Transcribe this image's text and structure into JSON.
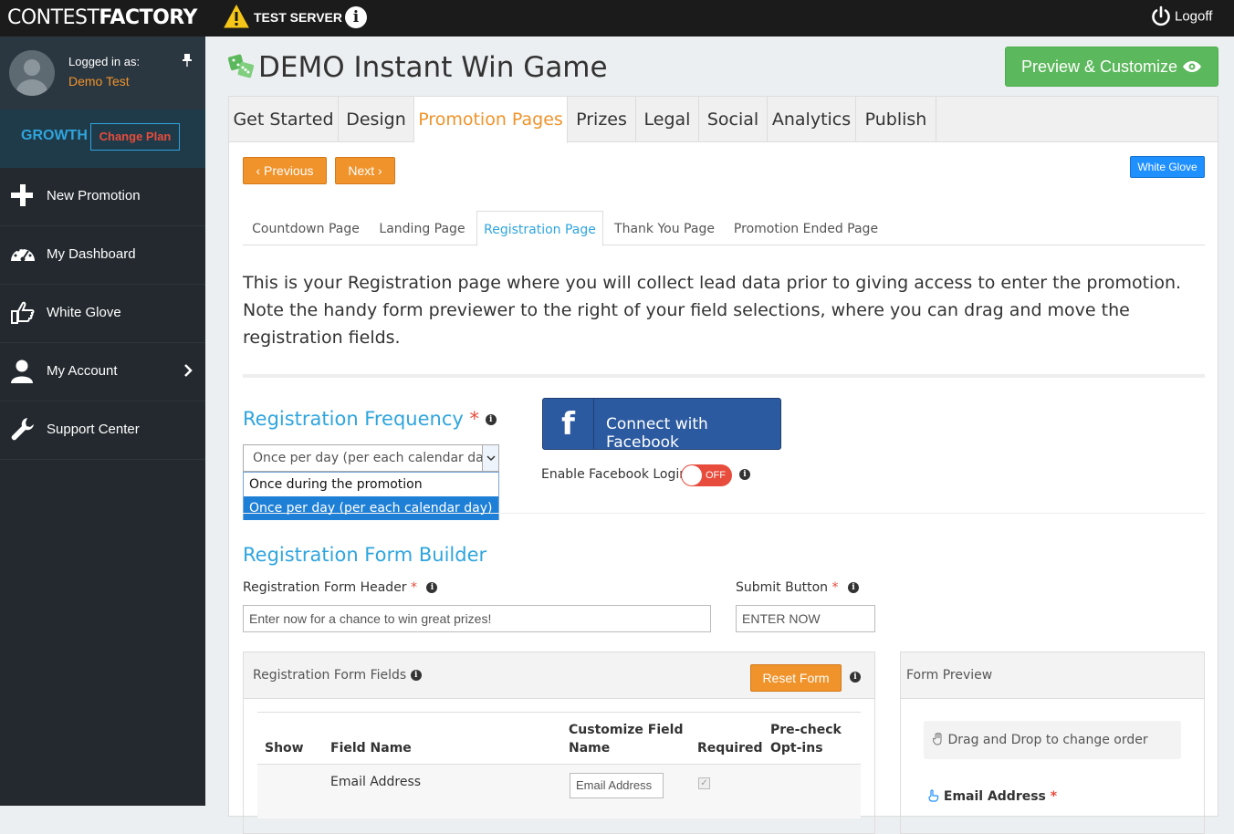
{
  "topbar": {
    "logo_light": "CONTEST",
    "logo_bold": "FACTORY",
    "server_label": "TEST SERVER",
    "info_glyph": "i",
    "logoff_label": "Logoff"
  },
  "sidebar": {
    "logged_in_label": "Logged in as:",
    "username": "Demo Test",
    "plan": "GROWTH",
    "change_plan_label": "Change Plan",
    "items": [
      {
        "label": "New Promotion",
        "icon": "plus-icon"
      },
      {
        "label": "My Dashboard",
        "icon": "dashboard-icon"
      },
      {
        "label": "White Glove",
        "icon": "hand-pointer-icon"
      },
      {
        "label": "My Account",
        "icon": "user-icon"
      },
      {
        "label": "Support Center",
        "icon": "wrench-icon"
      }
    ]
  },
  "header": {
    "title": "DEMO Instant Win Game",
    "preview_label": "Preview & Customize"
  },
  "tabs": [
    "Get Started",
    "Design",
    "Promotion Pages",
    "Prizes",
    "Legal",
    "Social",
    "Analytics",
    "Publish"
  ],
  "active_tab": "Promotion Pages",
  "buttons": {
    "previous": "‹ Previous",
    "next": "Next ›",
    "white_glove": "White Glove"
  },
  "subtabs": [
    "Countdown Page",
    "Landing Page",
    "Registration Page",
    "Thank You Page",
    "Promotion Ended Page"
  ],
  "active_subtab": "Registration Page",
  "intro_text": "This is your Registration page where you will collect lead data prior to giving access to enter the promotion. Note the handy form previewer to the right of your field selections, where you can drag and move the registration fields.",
  "frequency": {
    "title": "Registration Frequency",
    "required_mark": "*",
    "selected": "Once per day (per each calendar day)",
    "options": [
      "Once during the promotion",
      "Once per day (per each calendar day)"
    ]
  },
  "facebook": {
    "f_glyph": "f",
    "button_label": "Connect with Facebook",
    "enable_label": "Enable Facebook Login",
    "toggle_state": "OFF"
  },
  "form_builder": {
    "title": "Registration Form Builder",
    "header_label": "Registration Form Header",
    "header_value": "Enter now for a chance to win great prizes!",
    "submit_label": "Submit Button",
    "submit_value": "ENTER NOW",
    "required_mark": "*"
  },
  "fields_panel": {
    "title": "Registration Form Fields",
    "reset_label": "Reset Form",
    "columns": {
      "show": "Show",
      "field_name": "Field Name",
      "customize_1": "Customize Field",
      "customize_2": "Name",
      "required": "Required",
      "precheck_1": "Pre-check",
      "precheck_2": "Opt-ins"
    },
    "rows": [
      {
        "field_name": "Email Address",
        "custom_name": "Email Address",
        "required": true
      }
    ]
  },
  "preview_panel": {
    "title": "Form Preview",
    "drag_hint": "Drag and Drop to change order",
    "field_label": "Email Address",
    "required_mark": "*"
  },
  "colors": {
    "accent_orange": "#f0932b",
    "accent_blue": "#2fa5de",
    "green": "#5cb85c",
    "facebook": "#2c5aa0"
  }
}
